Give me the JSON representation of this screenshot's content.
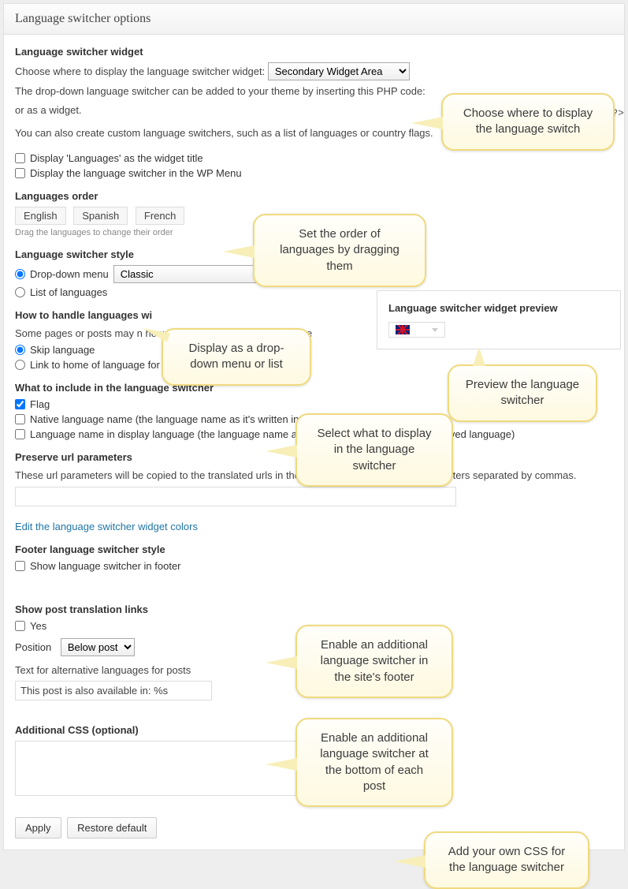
{
  "panel_title": "Language switcher options",
  "widget": {
    "heading": "Language switcher widget",
    "choose_label": "Choose where to display the language switcher widget:",
    "select_value": "Secondary Widget Area",
    "desc1": "The drop-down language switcher can be added to your theme by inserting this PHP code:",
    "desc1_suffix": "or as a widget.",
    "code_tail": "; ?>",
    "desc2": "You can also create custom language switchers, such as a list of languages or country flags.",
    "cb1": "Display 'Languages' as the widget title",
    "cb2": "Display the language switcher in the WP Menu"
  },
  "order": {
    "heading": "Languages order",
    "langs": [
      "English",
      "Spanish",
      "French"
    ],
    "hint": "Drag the languages to change their order"
  },
  "style": {
    "heading": "Language switcher style",
    "r1": "Drop-down menu",
    "select_value": "Classic",
    "r2": "List of languages"
  },
  "missing": {
    "heading": "How to handle languages wi",
    "desc": "Some pages or posts may n                                                                                 how the language selector should be",
    "r1": "Skip language",
    "r2": "Link to home of language for missing translations"
  },
  "include": {
    "heading": "What to include in the language switcher",
    "cb1": "Flag",
    "cb2": "Native language name (the language name as it's written in that language)",
    "cb3": "Language name in display language (the language name as it's written in the currently displayed language)"
  },
  "preserve": {
    "heading": "Preserve url parameters",
    "desc": "These url parameters will be copied to the translated urls in the language switcher. Enter parameters separated by commas."
  },
  "colors_link": "Edit the language switcher widget colors",
  "footer": {
    "heading": "Footer language switcher style",
    "cb": "Show language switcher in footer"
  },
  "post_links": {
    "heading": "Show post translation links",
    "cb": "Yes",
    "pos_label": "Position",
    "pos_value": "Below post",
    "alt_label": "Text for alternative languages for posts",
    "alt_value": "This post is also available in: %s"
  },
  "css": {
    "heading": "Additional CSS (optional)"
  },
  "buttons": {
    "apply": "Apply",
    "restore": "Restore default"
  },
  "preview": {
    "title": "Language switcher widget preview"
  },
  "callouts": {
    "c1": "Choose where to display the language switch",
    "c2": "Set the order of languages by dragging them",
    "c3": "Display as a drop-down menu or list",
    "c4": "Preview the language switcher",
    "c5": "Select what to display in the language switcher",
    "c6": "Enable an additional language switcher in the site's footer",
    "c7": "Enable an additional language switcher at the bottom of each post",
    "c8": "Add your own CSS for the language switcher"
  }
}
